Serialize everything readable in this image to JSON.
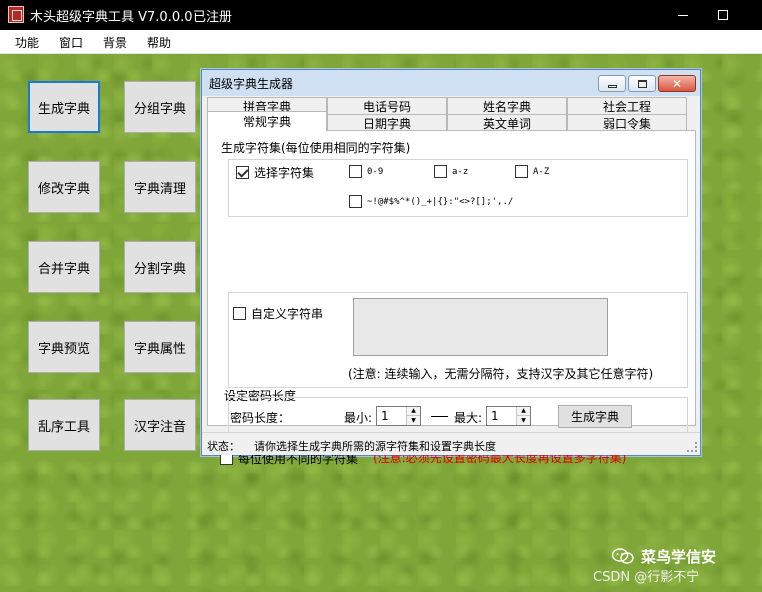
{
  "window": {
    "title": "木头超级字典工具 V7.0.0.0",
    "registration": "已注册"
  },
  "menu": [
    "功能",
    "窗口",
    "背景",
    "帮助"
  ],
  "tools": [
    "生成字典",
    "分组字典",
    "修改字典",
    "字典清理",
    "合并字典",
    "分割字典",
    "字典预览",
    "字典属性",
    "乱序工具",
    "汉字注音"
  ],
  "dialog": {
    "title": "超级字典生成器",
    "tabs_back": [
      "拼音字典",
      "电话号码",
      "姓名字典",
      "社会工程"
    ],
    "tabs_front": [
      "常规字典",
      "日期字典",
      "英文单词",
      "弱口令集"
    ],
    "charset_section": "生成字符集(每位使用相同的字符集)",
    "charset": {
      "select_label": "选择字符集",
      "digits": "0-9",
      "lower": "a-z",
      "upper": "A-Z",
      "symbols": "~!@#$%^*()_+|{}:\"<>?[];',./",
      "select_checked": true
    },
    "custom_label": "自定义字符串",
    "note": "(注意: 连续输入，无需分隔符，支持汉字及其它任意字符)",
    "length_section": "设定密码长度",
    "length_label": "密码长度：",
    "min_label": "最小:",
    "min_value": "1",
    "max_label": "最大:",
    "max_value": "1",
    "generate_button": "生成字典",
    "per_position_label": "每位使用不同的字符集",
    "warning": "(注意:必须先设置密码最大长度再设置多字符集)",
    "status_label": "状态：",
    "status_text": "请你选择生成字典所需的源字符集和设置字典长度"
  },
  "watermark": {
    "name": "菜鸟学信安",
    "csdn": "CSDN @行影不宁"
  },
  "colors": {
    "accent": "#1a78d6",
    "warning": "#e00000",
    "grass": "#7fa639"
  }
}
